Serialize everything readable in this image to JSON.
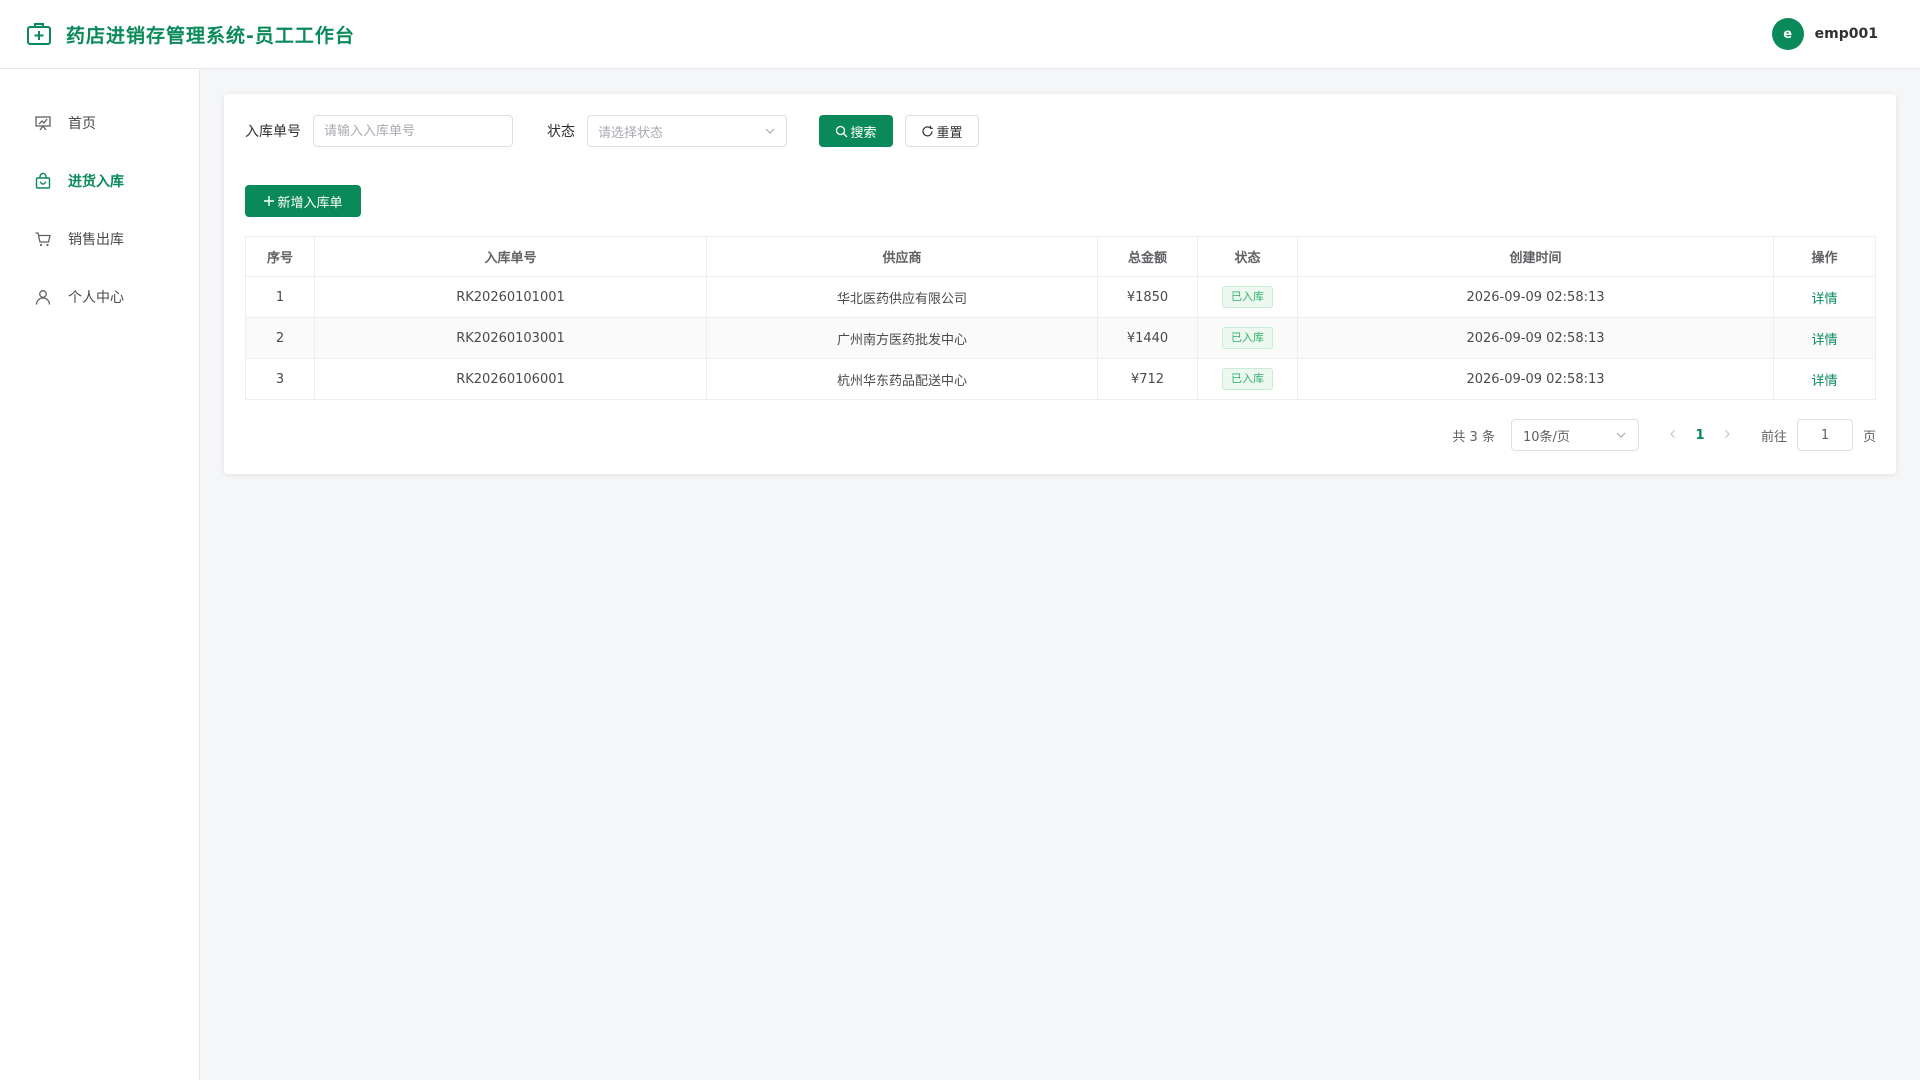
{
  "header": {
    "title": "药店进销存管理系统-员工工作台",
    "user": {
      "avatar_letter": "e",
      "username": "emp001"
    }
  },
  "sidebar": {
    "items": [
      {
        "label": "首页",
        "icon": "monitor-chart-icon",
        "active": false
      },
      {
        "label": "进货入库",
        "icon": "shopping-bag-icon",
        "active": true
      },
      {
        "label": "销售出库",
        "icon": "cart-icon",
        "active": false
      },
      {
        "label": "个人中心",
        "icon": "user-icon",
        "active": false
      }
    ]
  },
  "search": {
    "order_label": "入库单号",
    "order_placeholder": "请输入入库单号",
    "status_label": "状态",
    "status_placeholder": "请选择状态",
    "search_button": "搜索",
    "reset_button": "重置"
  },
  "actions": {
    "add_button": "新增入库单"
  },
  "table": {
    "columns": [
      "序号",
      "入库单号",
      "供应商",
      "总金额",
      "状态",
      "创建时间",
      "操作"
    ],
    "rows": [
      {
        "index": "1",
        "order_no": "RK20260101001",
        "supplier": "华北医药供应有限公司",
        "amount": "¥1850",
        "status": "已入库",
        "created_at": "2026-09-09 02:58:13",
        "action": "详情"
      },
      {
        "index": "2",
        "order_no": "RK20260103001",
        "supplier": "广州南方医药批发中心",
        "amount": "¥1440",
        "status": "已入库",
        "created_at": "2026-09-09 02:58:13",
        "action": "详情"
      },
      {
        "index": "3",
        "order_no": "RK20260106001",
        "supplier": "杭州华东药品配送中心",
        "amount": "¥712",
        "status": "已入库",
        "created_at": "2026-09-09 02:58:13",
        "action": "详情"
      }
    ]
  },
  "pagination": {
    "total": "共 3 条",
    "page_size": "10条/页",
    "current_page": "1",
    "jump_label": "前往",
    "jump_value": "1",
    "jump_unit": "页"
  },
  "colors": {
    "primary": "#0a8a5a",
    "tag_text": "#2fb26b",
    "tag_bg": "#edf8f1"
  }
}
